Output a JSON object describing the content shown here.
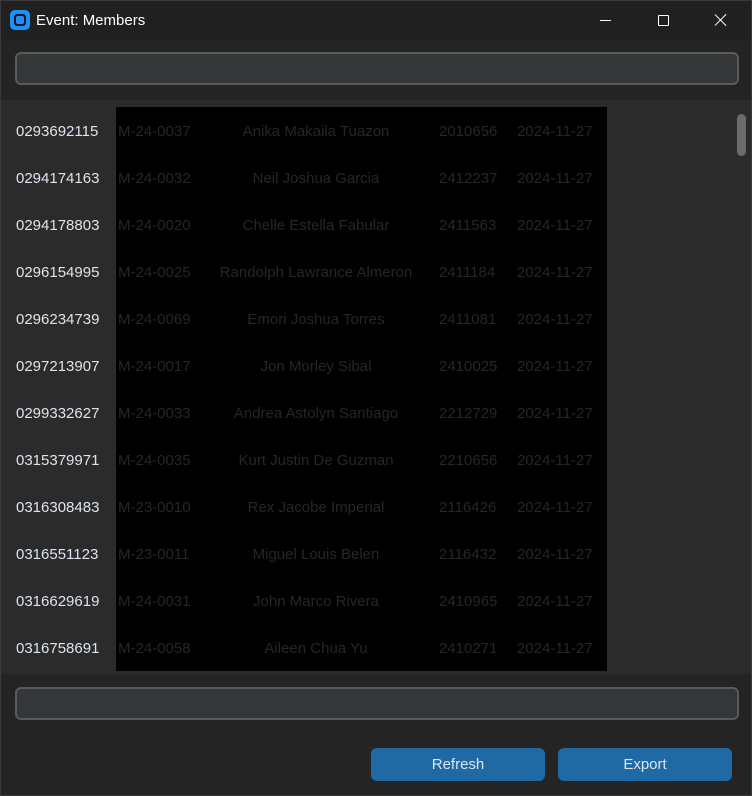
{
  "window": {
    "title": "Event: Members"
  },
  "search": {
    "value": ""
  },
  "bottom_input": {
    "value": ""
  },
  "members": [
    {
      "rfid": "0293692115",
      "student_id": "M-24-0037",
      "name": "Anika Makaila Tuazon",
      "number": "2010656",
      "date": "2024-11-27"
    },
    {
      "rfid": "0294174163",
      "student_id": "M-24-0032",
      "name": "Neil Joshua Garcia",
      "number": "2412237",
      "date": "2024-11-27"
    },
    {
      "rfid": "0294178803",
      "student_id": "M-24-0020",
      "name": "Chelle Estella Fabular",
      "number": "2411563",
      "date": "2024-11-27"
    },
    {
      "rfid": "0296154995",
      "student_id": "M-24-0025",
      "name": "Randolph Lawrance Almeron",
      "number": "2411184",
      "date": "2024-11-27"
    },
    {
      "rfid": "0296234739",
      "student_id": "M-24-0069",
      "name": "Emori Joshua Torres",
      "number": "2411081",
      "date": "2024-11-27"
    },
    {
      "rfid": "0297213907",
      "student_id": "M-24-0017",
      "name": "Jon Morley Sibal",
      "number": "2410025",
      "date": "2024-11-27"
    },
    {
      "rfid": "0299332627",
      "student_id": "M-24-0033",
      "name": "Andrea Astolyn Santiago",
      "number": "2212729",
      "date": "2024-11-27"
    },
    {
      "rfid": "0315379971",
      "student_id": "M-24-0035",
      "name": "Kurt Justin De Guzman",
      "number": "2210656",
      "date": "2024-11-27"
    },
    {
      "rfid": "0316308483",
      "student_id": "M-23-0010",
      "name": "Rex Jacobe Imperial",
      "number": "2116426",
      "date": "2024-11-27"
    },
    {
      "rfid": "0316551123",
      "student_id": "M-23-0011",
      "name": "Miguel Louis Belen",
      "number": "2116432",
      "date": "2024-11-27"
    },
    {
      "rfid": "0316629619",
      "student_id": "M-24-0031",
      "name": "John Marco Rivera",
      "number": "2410965",
      "date": "2024-11-27"
    },
    {
      "rfid": "0316758691",
      "student_id": "M-24-0058",
      "name": "Aileen Chua Yu",
      "number": "2410271",
      "date": "2024-11-27"
    }
  ],
  "buttons": {
    "refresh": "Refresh",
    "export": "Export"
  },
  "colors": {
    "accent": "#1f6aa5",
    "background": "#242424",
    "list_background": "#2b2b2b",
    "entry_border": "#565b5e"
  },
  "icons": {
    "app": "app-icon",
    "minimize": "minimize-icon",
    "maximize": "maximize-icon",
    "close": "close-icon"
  }
}
